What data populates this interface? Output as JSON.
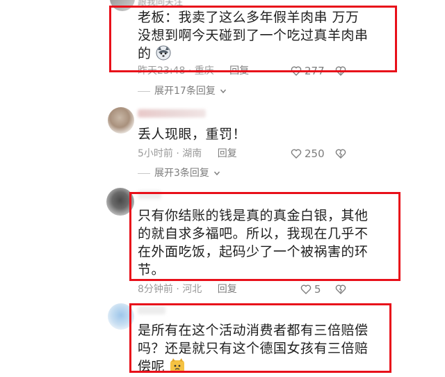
{
  "comments": [
    {
      "name_fragment": "跟我同关注",
      "lines": [
        "老板：我卖了这么多年假羊肉串 万万",
        "没想到啊今天碰到了一个吃过真羊肉串",
        "的"
      ],
      "time": "昨天23:48",
      "location": "重庆",
      "reply_label": "回复",
      "likes": "277",
      "expand_label": "展开17条回复"
    },
    {
      "lines": [
        "丢人现眼，重罚！"
      ],
      "time": "5小时前",
      "location": "湖南",
      "reply_label": "回复",
      "likes": "250",
      "expand_label": "展开3条回复"
    },
    {
      "lines": [
        "只有你结账的钱是真的真金白银，其他",
        "的就自求多福吧。所以，我现在几乎不",
        "在外面吃饭，起码少了一个被祸害的环",
        "节。"
      ],
      "time": "8分钟前",
      "location": "河北",
      "reply_label": "回复",
      "likes": "5"
    },
    {
      "lines": [
        "是所有在这个活动消费者都有三倍赔偿",
        "吗？还是就只有这个德国女孩有三倍赔",
        "偿呢"
      ]
    }
  ],
  "separator": "·",
  "colors": {
    "highlight": "#e8101a",
    "meta": "#9a9a9a",
    "text": "#1e1e1e"
  },
  "icons": [
    "heart-icon",
    "dislike-heart-icon",
    "chevron-down-icon",
    "husky-emoji-icon",
    "cat-emoji-icon"
  ]
}
